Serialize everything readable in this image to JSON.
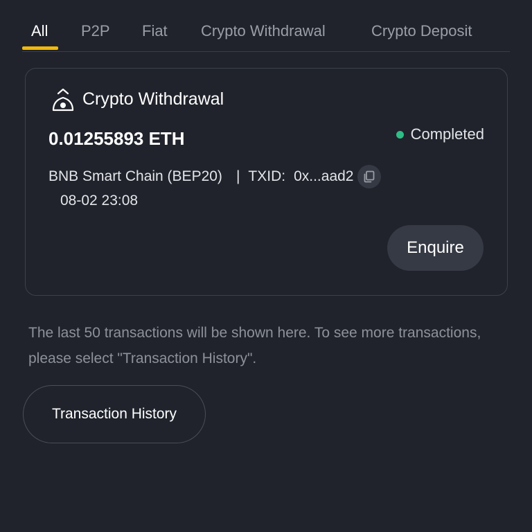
{
  "tabs": [
    {
      "label": "All",
      "active": true
    },
    {
      "label": "P2P",
      "active": false
    },
    {
      "label": "Fiat",
      "active": false
    },
    {
      "label": "Crypto Withdrawal",
      "active": false
    },
    {
      "label": "Crypto Deposit",
      "active": false
    }
  ],
  "transaction": {
    "type_icon": "withdrawal-icon",
    "type_label": "Crypto Withdrawal",
    "amount": "0.01255893 ETH",
    "status": "Completed",
    "status_color": "#2ebd85",
    "network": "BNB Smart Chain (BEP20)",
    "separator": "|",
    "txid_label": "TXID:",
    "txid": "0x...aad2",
    "copy_icon": "copy-icon",
    "time": "08-02 23:08",
    "enquire_label": "Enquire"
  },
  "note": "The last 50 transactions will be shown here. To see more transactions, please select \"Transaction History\".",
  "history_button": "Transaction History",
  "colors": {
    "background": "#20232b",
    "accent": "#f0b90b",
    "success": "#2ebd85"
  }
}
